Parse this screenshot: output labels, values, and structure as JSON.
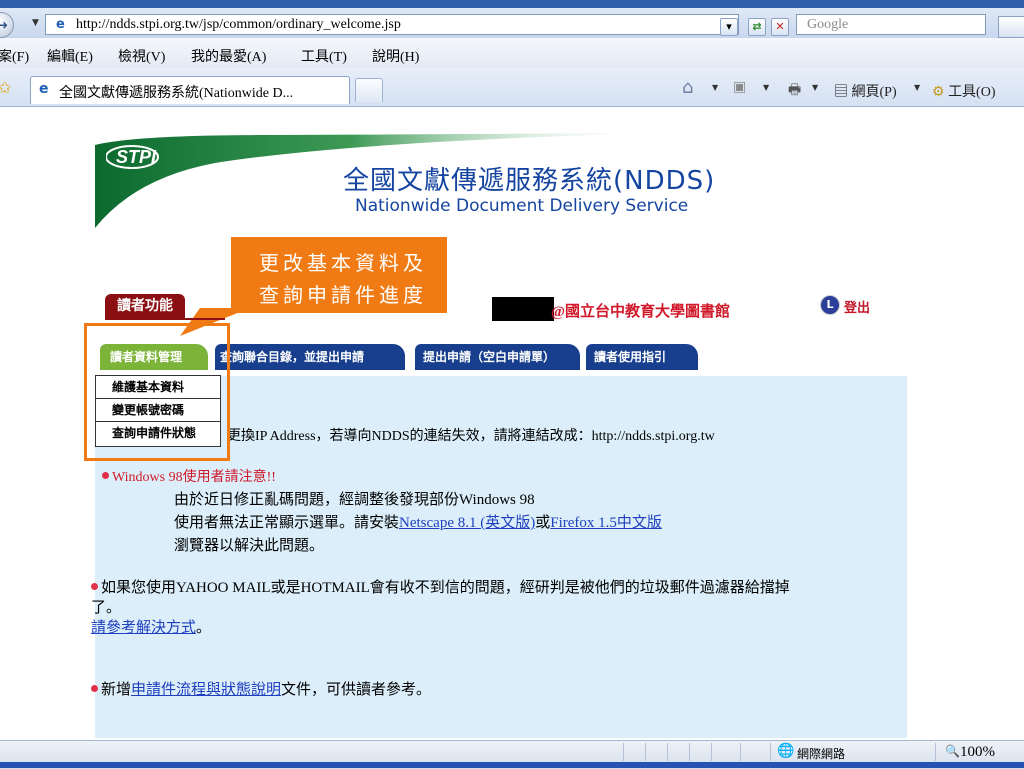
{
  "browser": {
    "url": "http://ndds.stpi.org.tw/jsp/common/ordinary_welcome.jsp",
    "search_placeholder": "Google",
    "menu": [
      "案(F)",
      "編輯(E)",
      "檢視(V)",
      "我的最愛(A)",
      "工具(T)",
      "說明(H)"
    ],
    "tab_title": "全國文獻傳遞服務系統(Nationwide D...",
    "toolbar": {
      "page_label": "網頁(P)",
      "tools_label": "工具(O)"
    },
    "status": {
      "zone": "網際網路",
      "zoom": "100%"
    }
  },
  "banner": {
    "logo": "STPI",
    "title": "全國文獻傳遞服務系統(NDDS)",
    "subtitle": "Nationwide Document Delivery Service"
  },
  "callout": {
    "line1": "更改基本資料及",
    "line2": "查詢申請件進度"
  },
  "header": {
    "reader_functions": "讀者功能",
    "user_library": "@國立台中教育大學圖書館",
    "logout": "登出"
  },
  "tabs": {
    "reader_mgmt": "讀者資料管理",
    "query": "查詢聯合目錄，並提出申請",
    "request": "提出申請（空白申請單）",
    "guide": "讀者使用指引"
  },
  "dropdown": [
    "維護基本資料",
    "變更帳號密碼",
    "查詢申請件狀態"
  ],
  "notices": {
    "ip_notice": "更換IP Address，若導向NDDS的連結失效，請將連結改成：http://ndds.stpi.org.tw",
    "win98_title": "Windows 98使用者請注意!!",
    "win98_line1": "由於近日修正亂碼問題，經調整後發現部份Windows 98",
    "win98_line2_pre": "使用者無法正常顯示選單。請安裝",
    "win98_link1": "Netscape 8.1 (英文版)",
    "win98_or": "或",
    "win98_link2": "Firefox 1.5中文版",
    "win98_line3": "瀏覽器以解決此問題。",
    "mail_line1": "如果您使用YAHOO MAIL或是HOTMAIL會有收不到信的問題，經研判是被他們的垃圾郵件過濾器給擋掉",
    "mail_line2": "了。",
    "mail_link": "請參考解決方式",
    "mail_link_suffix": "。",
    "new_prefix": "新增",
    "new_link": "申請件流程與狀態說明",
    "new_suffix": "文件，可供讀者參考。"
  },
  "colors": {
    "accent": "#f07a13",
    "tab_green": "#7cb43a",
    "tab_blue": "#173f8e",
    "brand_red": "#8b0f12",
    "content_bg": "#dbeef9"
  }
}
